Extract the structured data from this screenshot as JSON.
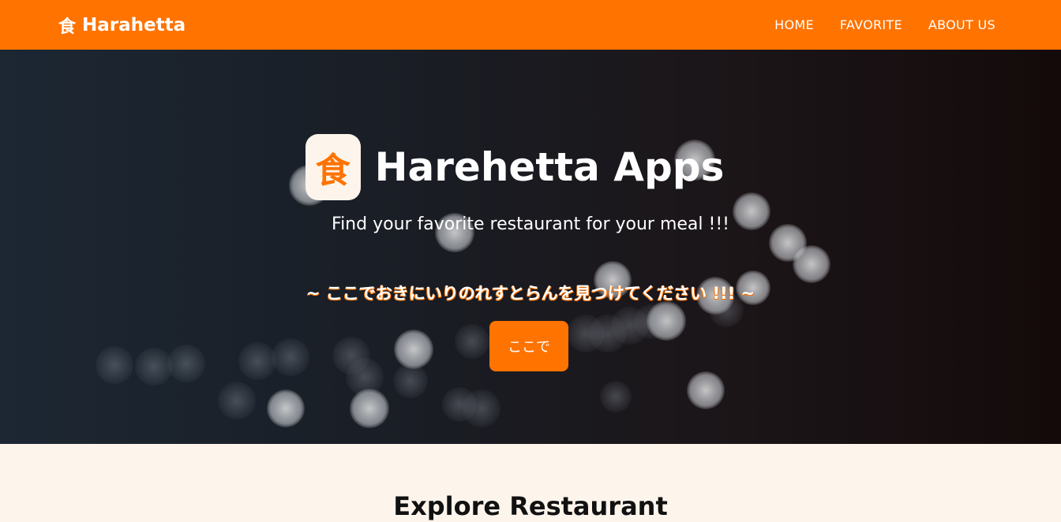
{
  "navbar": {
    "brand_icon": "食",
    "brand": "Harahetta",
    "links": [
      "HOME",
      "FAVORITE",
      "ABOUT US"
    ]
  },
  "hero": {
    "logo_char": "食",
    "title": "Harehetta Apps",
    "subtitle": "Find your favorite restaurant for your meal !!!",
    "tagline": "~ ここでおきにいりのれすとらんを見つけてください !!! ~",
    "button": "ここで"
  },
  "explore": {
    "title": "Explore Restaurant"
  },
  "colors": {
    "accent": "#ff7300",
    "cream": "#fdf5ec",
    "hero_dark": "#1a1e26"
  }
}
